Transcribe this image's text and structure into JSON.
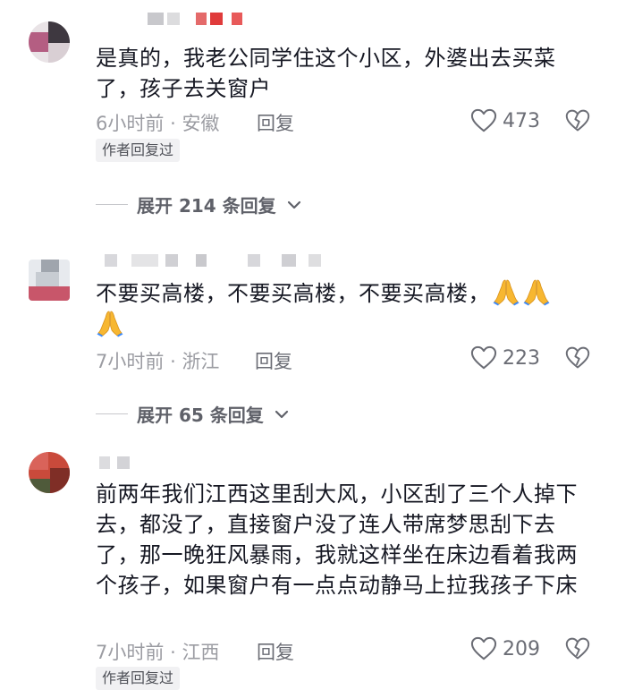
{
  "comments": [
    {
      "text": "是真的，我老公同学住这个小区，外婆出去买菜了，孩子去关窗户",
      "time": "6小时前",
      "location": "安徽",
      "reply_label": "回复",
      "likes": "473",
      "author_tag": "作者回复过",
      "expand_label": "展开 214 条回复"
    },
    {
      "text": "不要买高楼，不要买高楼，不要买高楼，",
      "emojis": [
        "folded-hands",
        "folded-hands",
        "folded-hands"
      ],
      "time": "7小时前",
      "location": "浙江",
      "reply_label": "回复",
      "likes": "223",
      "expand_label": "展开 65 条回复"
    },
    {
      "text": "前两年我们江西这里刮大风，小区刮了三个人掉下去，都没了，直接窗户没了连人带席梦思刮下去了，那一晚狂风暴雨，我就这样坐在床边看着我两个孩子，如果窗户有一点点动静马上拉我孩子下床",
      "time": "7小时前",
      "location": "江西",
      "reply_label": "回复",
      "likes": "209",
      "author_tag": "作者回复过"
    }
  ],
  "meta_separator": "·",
  "icons": {
    "like": "heart-outline-icon",
    "dislike": "broken-heart-icon",
    "expand": "chevron-down-icon"
  },
  "colors": {
    "text": "#161823",
    "meta": "#9b9ca2",
    "tag_bg": "#f1f1f3"
  }
}
